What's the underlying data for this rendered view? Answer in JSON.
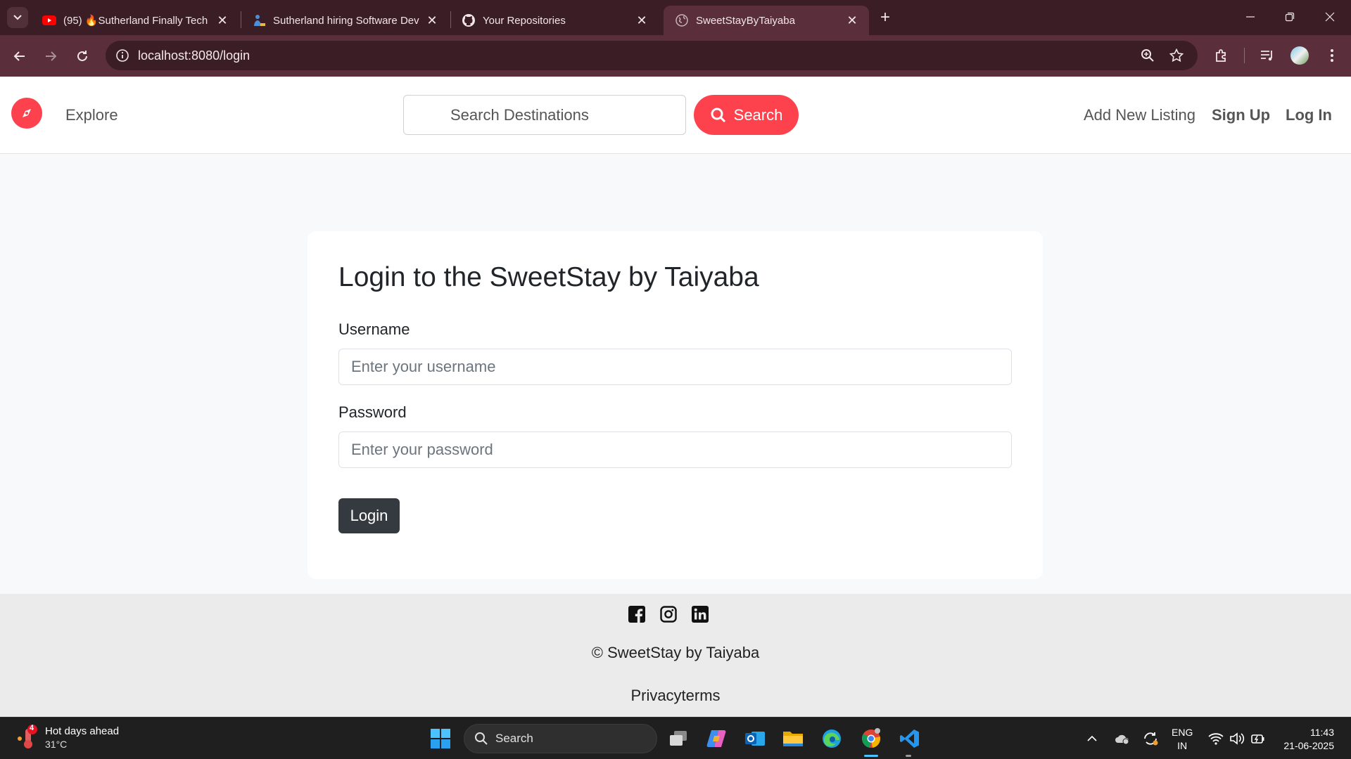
{
  "browser": {
    "tabs": [
      {
        "badge": "(95)",
        "title": "🔥Sutherland Finally Tech Hiring",
        "favicon": "youtube-icon"
      },
      {
        "title": "Sutherland hiring Software Developer",
        "favicon": "job-site-icon"
      },
      {
        "title": "Your Repositories",
        "favicon": "github-icon"
      },
      {
        "title": "SweetStayByTaiyaba",
        "favicon": "globe-icon",
        "active": true
      }
    ],
    "url": "localhost:8080/login"
  },
  "navbar": {
    "explore": "Explore",
    "search_placeholder": "Search Destinations",
    "search_button": "Search",
    "add_listing": "Add New Listing",
    "sign_up": "Sign Up",
    "log_in": "Log In",
    "brand_color": "#fe424d"
  },
  "login": {
    "title": "Login to the SweetStay by Taiyaba",
    "username_label": "Username",
    "username_placeholder": "Enter your username",
    "password_label": "Password",
    "password_placeholder": "Enter your password",
    "submit": "Login"
  },
  "footer": {
    "socials": [
      "facebook-icon",
      "instagram-icon",
      "linkedin-icon"
    ],
    "copyright": "© SweetStay by Taiyaba",
    "privacy": "Privacyterms"
  },
  "taskbar": {
    "weather_title": "Hot days ahead",
    "weather_temp": "31°C",
    "weather_badge": "4",
    "search": "Search",
    "lang_line1": "ENG",
    "lang_line2": "IN",
    "time": "11:43",
    "date": "21-06-2025"
  }
}
